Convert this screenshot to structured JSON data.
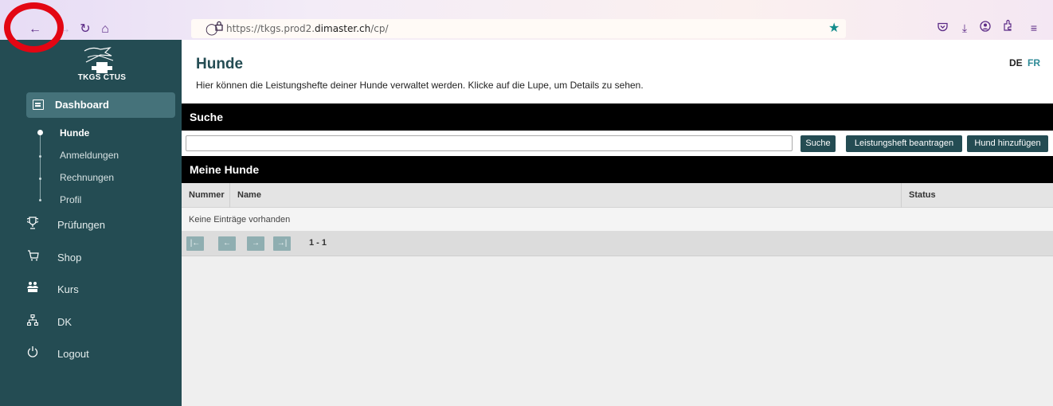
{
  "browser": {
    "url_prefix": "https://tkgs.prod2.",
    "url_domain": "dimaster.ch",
    "url_path": "/cp/",
    "icons": [
      "back-arrow-icon",
      "forward-arrow-icon",
      "reload-icon",
      "home-icon",
      "shield-icon",
      "lock-icon",
      "bookmark-star-icon",
      "pocket-icon",
      "download-icon",
      "account-icon",
      "extensions-icon",
      "menu-icon"
    ]
  },
  "sidebar": {
    "logo_text": "TKGS CTUS",
    "dashboard_label": "Dashboard",
    "sub_items": [
      {
        "label": "Hunde",
        "active": true
      },
      {
        "label": "Anmeldungen",
        "active": false
      },
      {
        "label": "Rechnungen",
        "active": false
      },
      {
        "label": "Profil",
        "active": false
      }
    ],
    "menu": [
      {
        "label": "Prüfungen",
        "icon": "trophy-icon"
      },
      {
        "label": "Shop",
        "icon": "cart-icon"
      },
      {
        "label": "Kurs",
        "icon": "people-icon"
      },
      {
        "label": "DK",
        "icon": "hierarchy-icon"
      },
      {
        "label": "Logout",
        "icon": "power-icon"
      }
    ]
  },
  "main": {
    "title": "Hunde",
    "description": "Hier können die Leistungshefte deiner Hunde verwaltet werden. Klicke auf die Lupe, um Details zu sehen.",
    "lang_de": "DE",
    "lang_fr": "FR",
    "search_section": "Suche",
    "search_value": "",
    "buttons": {
      "search": "Suche",
      "request_booklet": "Leistungsheft beantragen",
      "add_dog": "Hund hinzufügen"
    },
    "list_section": "Meine Hunde",
    "columns": [
      "Nummer",
      "Name",
      "Status"
    ],
    "empty_text": "Keine Einträge vorhanden",
    "pager": {
      "first": "|←",
      "prev": "←",
      "next": "→",
      "last": "→|",
      "info": "1 - 1"
    }
  },
  "colors": {
    "sidebar": "#244c53",
    "sidebar_active": "#45727a",
    "button": "#244c53",
    "title": "#244c53",
    "annotation_ring": "#e30613"
  }
}
